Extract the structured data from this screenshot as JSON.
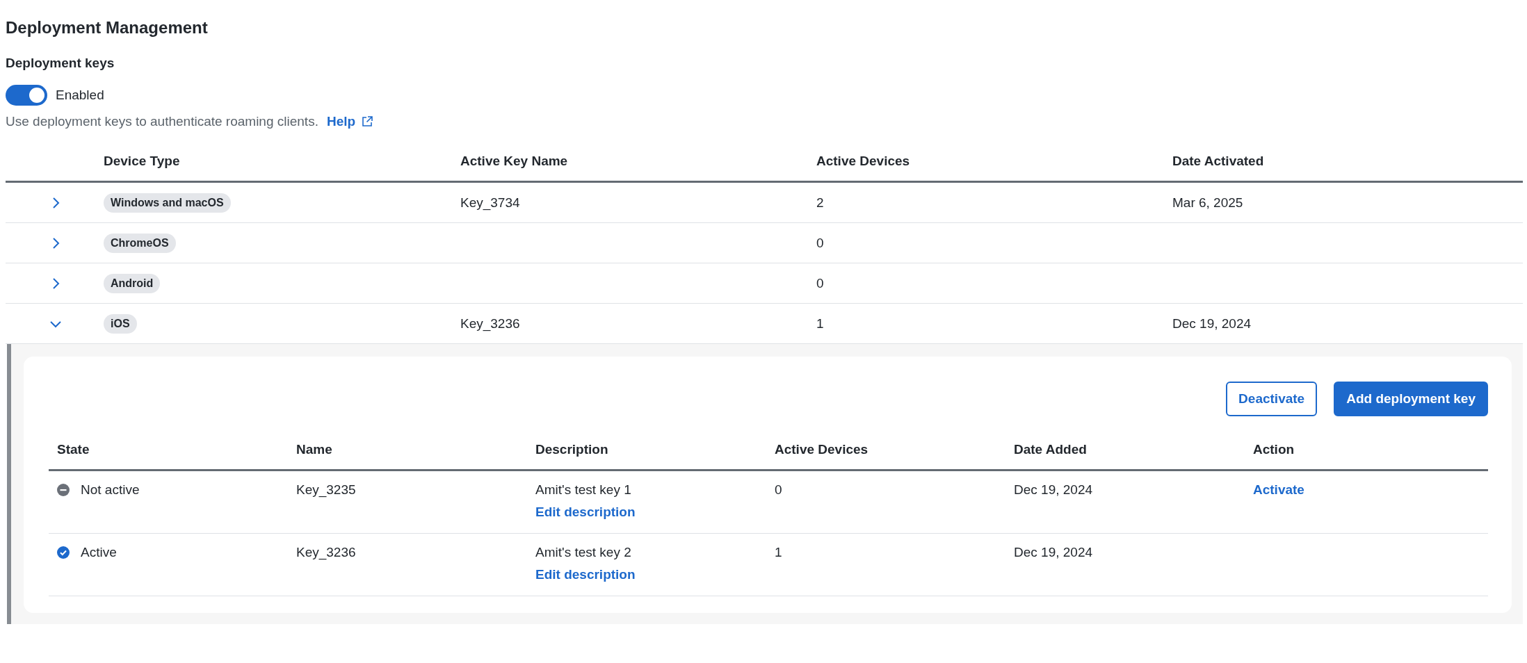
{
  "title": "Deployment Management",
  "section_title": "Deployment keys",
  "toggle": {
    "label": "Enabled",
    "on": true
  },
  "description": {
    "text": "Use deployment keys to authenticate roaming clients.",
    "link": "Help"
  },
  "table": {
    "columns": [
      "Device Type",
      "Active Key Name",
      "Active Devices",
      "Date Activated"
    ],
    "rows": [
      {
        "device_type": "Windows and macOS",
        "key_name": "Key_3734",
        "active_devices": "2",
        "date_activated": "Mar 6, 2025",
        "expanded": false
      },
      {
        "device_type": "ChromeOS",
        "active_devices": "0",
        "expanded": false
      },
      {
        "device_type": "Android",
        "active_devices": "0",
        "expanded": false
      },
      {
        "device_type": "iOS",
        "key_name": "Key_3236",
        "active_devices": "1",
        "date_activated": "Dec 19, 2024",
        "expanded": true,
        "details": {
          "buttons": [
            {
              "label": "Deactivate",
              "kind": "outline"
            },
            {
              "label": "Add deployment key",
              "kind": "primary"
            }
          ],
          "columns": [
            "State",
            "Name",
            "Description",
            "Active Devices",
            "Date Added",
            "Action"
          ],
          "rows": [
            {
              "state": "Not active",
              "kind": "inactive",
              "name": "Key_3235",
              "description": "Amit's test key 1",
              "edit_link": "Edit description",
              "active_devices": "0",
              "date_added": "Dec 19, 2024",
              "action": "Activate"
            },
            {
              "state": "Active",
              "kind": "active",
              "name": "Key_3236",
              "description": "Amit's test key 2",
              "edit_link": "Edit description",
              "active_devices": "1",
              "date_added": "Dec 19, 2024"
            }
          ]
        }
      }
    ]
  }
}
